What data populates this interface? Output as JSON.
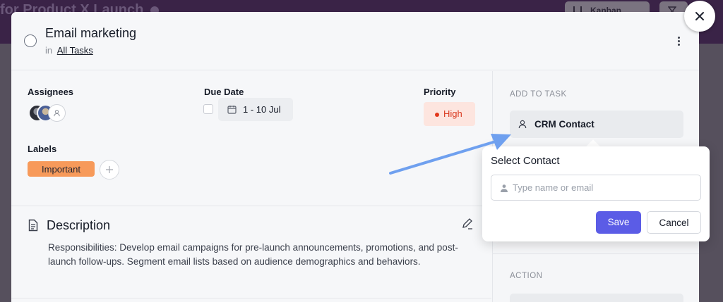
{
  "background": {
    "project_title": "for Product X Launch",
    "view_label": "Kanban"
  },
  "task": {
    "title": "Email marketing",
    "in_text": "in",
    "list_link": "All Tasks"
  },
  "fields": {
    "assignees_label": "Assignees",
    "due_label": "Due Date",
    "due_value": "1 - 10 Jul",
    "priority_label": "Priority",
    "priority_value": "High",
    "labels_label": "Labels",
    "label_tag": "Important"
  },
  "description": {
    "title": "Description",
    "text": "Responsibilities: Develop email campaigns for pre-launch announcements, promotions, and post-launch follow-ups. Segment email lists based on audience demographics and behaviors."
  },
  "sidebar": {
    "add_to_task": "ADD TO TASK",
    "crm_contact": "CRM Contact",
    "action": "ACTION"
  },
  "popover": {
    "title": "Select Contact",
    "placeholder": "Type name or email",
    "save": "Save",
    "cancel": "Cancel"
  },
  "colors": {
    "accent": "#5b5ce6",
    "priority_high": "#e2361a",
    "label_important": "#f79a5a",
    "annotation_arrow": "#6fa0ef"
  },
  "icons": [
    "info-icon",
    "kanban-icon",
    "filter-icon",
    "close-icon",
    "check-circle-icon",
    "more-vertical-icon",
    "avatar-add-icon",
    "calendar-icon",
    "plus-icon",
    "document-icon",
    "edit-icon",
    "user-icon",
    "arrow-annotation"
  ]
}
